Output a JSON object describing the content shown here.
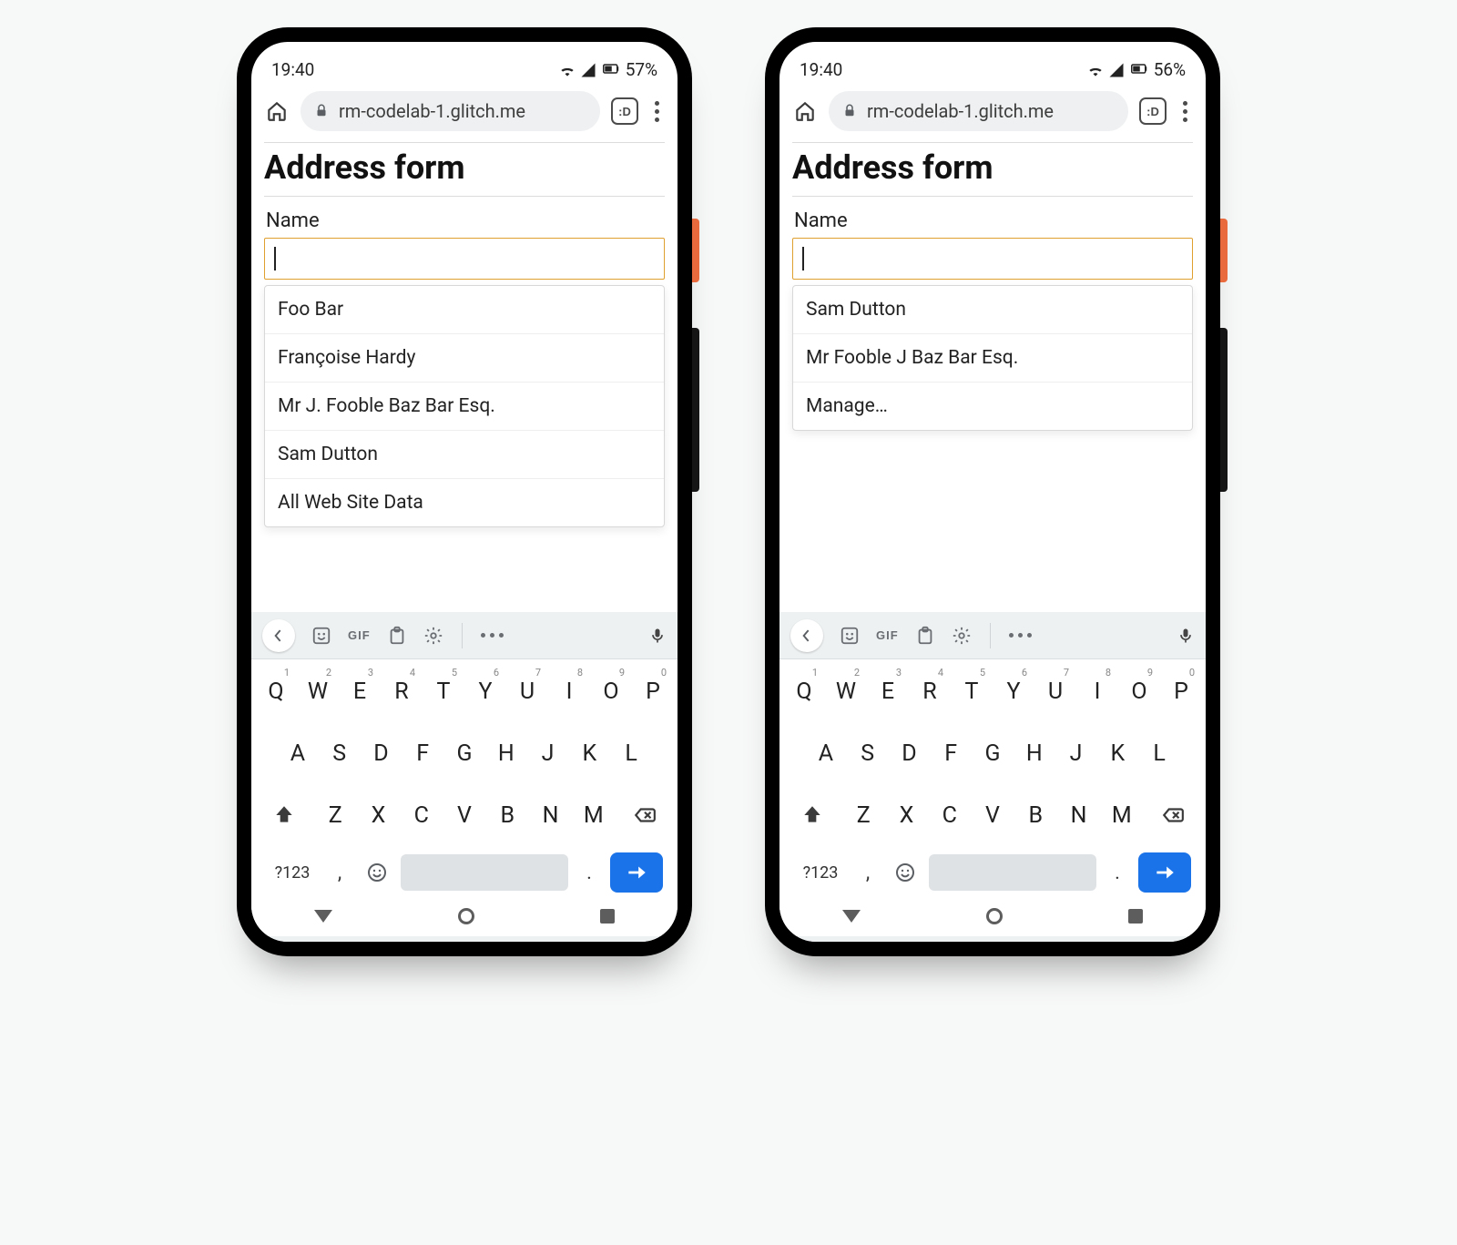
{
  "phones": [
    {
      "status": {
        "time": "19:40",
        "battery_text": "57%"
      },
      "browser": {
        "url": "rm-codelab-1.glitch.me",
        "tab_badge": ":D"
      },
      "page": {
        "title": "Address form",
        "field_label": "Name",
        "input_value": "",
        "suggestions": [
          "Foo Bar",
          "Françoise Hardy",
          "Mr J. Fooble Baz Bar Esq.",
          "Sam Dutton",
          "All Web Site Data"
        ]
      },
      "keyboard": {
        "gif_label": "GIF",
        "row1": [
          "Q",
          "W",
          "E",
          "R",
          "T",
          "Y",
          "U",
          "I",
          "O",
          "P"
        ],
        "row1_sup": [
          "1",
          "2",
          "3",
          "4",
          "5",
          "6",
          "7",
          "8",
          "9",
          "0"
        ],
        "row2": [
          "A",
          "S",
          "D",
          "F",
          "G",
          "H",
          "J",
          "K",
          "L"
        ],
        "row3": [
          "Z",
          "X",
          "C",
          "V",
          "B",
          "N",
          "M"
        ],
        "sym_label": "?123",
        "comma": ",",
        "period": "."
      }
    },
    {
      "status": {
        "time": "19:40",
        "battery_text": "56%"
      },
      "browser": {
        "url": "rm-codelab-1.glitch.me",
        "tab_badge": ":D"
      },
      "page": {
        "title": "Address form",
        "field_label": "Name",
        "input_value": "",
        "suggestions": [
          "Sam Dutton",
          "Mr Fooble J Baz Bar Esq.",
          "Manage…"
        ]
      },
      "keyboard": {
        "gif_label": "GIF",
        "row1": [
          "Q",
          "W",
          "E",
          "R",
          "T",
          "Y",
          "U",
          "I",
          "O",
          "P"
        ],
        "row1_sup": [
          "1",
          "2",
          "3",
          "4",
          "5",
          "6",
          "7",
          "8",
          "9",
          "0"
        ],
        "row2": [
          "A",
          "S",
          "D",
          "F",
          "G",
          "H",
          "J",
          "K",
          "L"
        ],
        "row3": [
          "Z",
          "X",
          "C",
          "V",
          "B",
          "N",
          "M"
        ],
        "sym_label": "?123",
        "comma": ",",
        "period": "."
      }
    }
  ]
}
